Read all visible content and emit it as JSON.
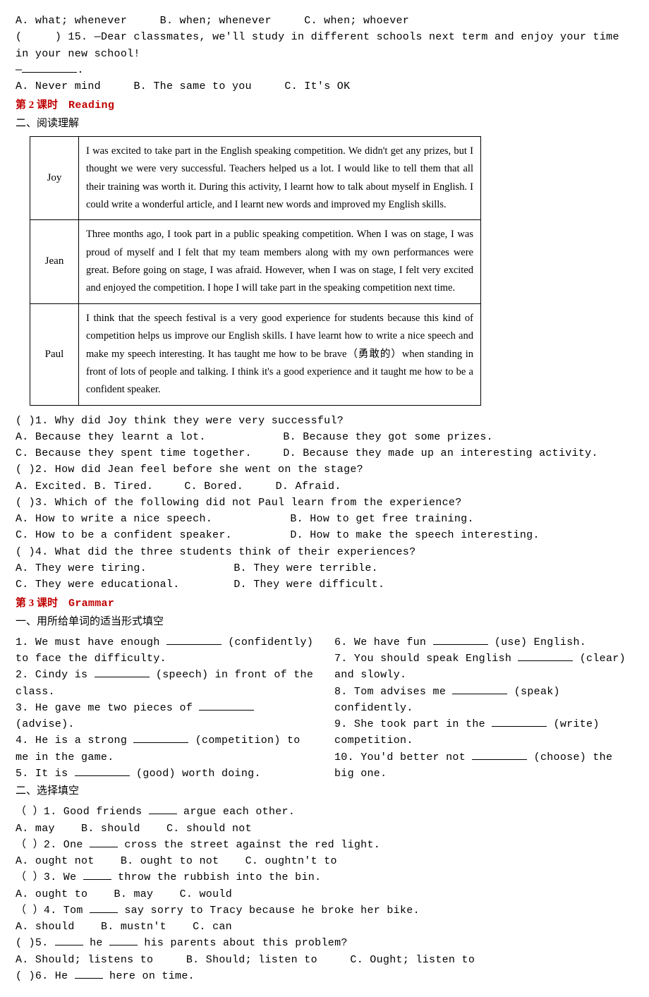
{
  "top": {
    "optA": "A. what; whenever",
    "optB": "B. when; whenever",
    "optC": "C. when; whoever",
    "q15_open": "(",
    "q15_close": ") 15. —Dear classmates, we'll study in different schools next term and enjoy your time in your new school!",
    "q15_dash": "—",
    "q15_period": ".",
    "q15_A": "A. Never mind",
    "q15_B": "B. The same to you",
    "q15_C": "C. It's OK"
  },
  "lesson2": {
    "title_cn": "第 2 课时",
    "title_en": "Reading",
    "sub": "二、阅读理解",
    "table": {
      "r1_name": "Joy",
      "r1_text": "I was excited to take part in the English speaking competition.  We didn't get any prizes, but I thought we were very successful.  Teachers helped us a lot.  I would like to tell them that all their training was worth it.  During this activity, I learnt how to talk about myself in English.  I could write a wonderful article, and I learnt new words and improved my English skills.",
      "r2_name": "Jean",
      "r2_text": "Three months ago, I took part in a public speaking competition.  When I was on stage, I was proud of myself and I felt that my team members along with my own performances were great.  Before going on stage, I was afraid.  However, when I was on stage, I felt very excited and enjoyed the competition.  I hope I will take part in the speaking competition next time.",
      "r3_name": "Paul",
      "r3_text": "I think that the speech festival is a very good experience for students because this kind of competition helps us improve our English skills.  I have learnt how to write a nice speech and make my speech interesting.  It has taught me how to be brave（勇敢的）when standing in front of lots of people and talking.  I think it's a good experience and it taught me how to be a confident speaker."
    },
    "q1": "(    )1. Why did Joy think they were very successful?",
    "q1A": "A. Because they learnt a lot.",
    "q1B": "B. Because they got some prizes.",
    "q1C": "C. Because they spent time together.",
    "q1D": "D. Because they made up an interesting activity.",
    "q2": "(    )2. How did Jean feel before she went on the stage?",
    "q2A": "A. Excited. B. Tired.",
    "q2C": "C. Bored.",
    "q2D": "D. Afraid.",
    "q3": "(    )3. Which of the following did not Paul learn from the experience?",
    "q3A": "A. How to write a nice speech.",
    "q3B": "B. How to get free training.",
    "q3C": "C. How to be a confident speaker.",
    "q3D": "D. How to make the speech interesting.",
    "q4": "(    )4. What did the three students think of their experiences?",
    "q4A": "A. They were tiring.",
    "q4B": "B. They were terrible.",
    "q4C": "C. They were educational.",
    "q4D": "D. They were difficult."
  },
  "lesson3": {
    "title_cn": "第 3 课时",
    "title_en": "Grammar",
    "sub1": "一、用所给单词的适当形式填空",
    "left": {
      "l1a": "1. We must have enough ",
      "l1b": " (confidently) to face the difficulty.",
      "l2a": "2. Cindy is ",
      "l2b": " (speech) in front of the class.",
      "l3a": "3. He gave me two pieces of ",
      "l3b": " (advise).",
      "l4a": "4. He is a strong ",
      "l4b": " (competition) to me in the game.",
      "l5a": "5. It is ",
      "l5b": " (good) worth doing."
    },
    "right": {
      "r6a": "6. We have fun ",
      "r6b": " (use) English.",
      "r7a": "7. You should speak English ",
      "r7b": " (clear) and slowly.",
      "r8a": "8. Tom advises me ",
      "r8b": " (speak) confidently.",
      "r9a": "9. She took part in the ",
      "r9b": " (write) competition.",
      "r10a": "10. You'd better not ",
      "r10b": " (choose) the big one."
    },
    "sub2": "二、选择填空",
    "c1": {
      "q": "（   ）1. Good friends ",
      "q2": " argue each other.",
      "A": "A. may",
      "B": "B. should",
      "C": "C. should not"
    },
    "c2": {
      "q": "（   ）2. One ",
      "q2": " cross the street against the red light.",
      "A": "A. ought not",
      "B": "B. ought to not",
      "C": "C. oughtn't to"
    },
    "c3": {
      "q": "（   ）3. We ",
      "q2": " throw the rubbish into the bin.",
      "A": "A. ought to",
      "B": "B. may",
      "C": "C. would"
    },
    "c4": {
      "q": "（   ）4. Tom ",
      "q2": " say sorry to Tracy because he broke her bike.",
      "A": "A. should",
      "B": "B. mustn't",
      "C": "C. can"
    },
    "c5": {
      "q": "(    )5. ",
      "q2": " he ",
      "q3": " his parents about this problem?",
      "A": "A. Should; listens to",
      "B": "B. Should; listen to",
      "C": "C. Ought; listen to"
    },
    "c6": {
      "q": "(    )6. He ",
      "q2": " here on time."
    }
  }
}
